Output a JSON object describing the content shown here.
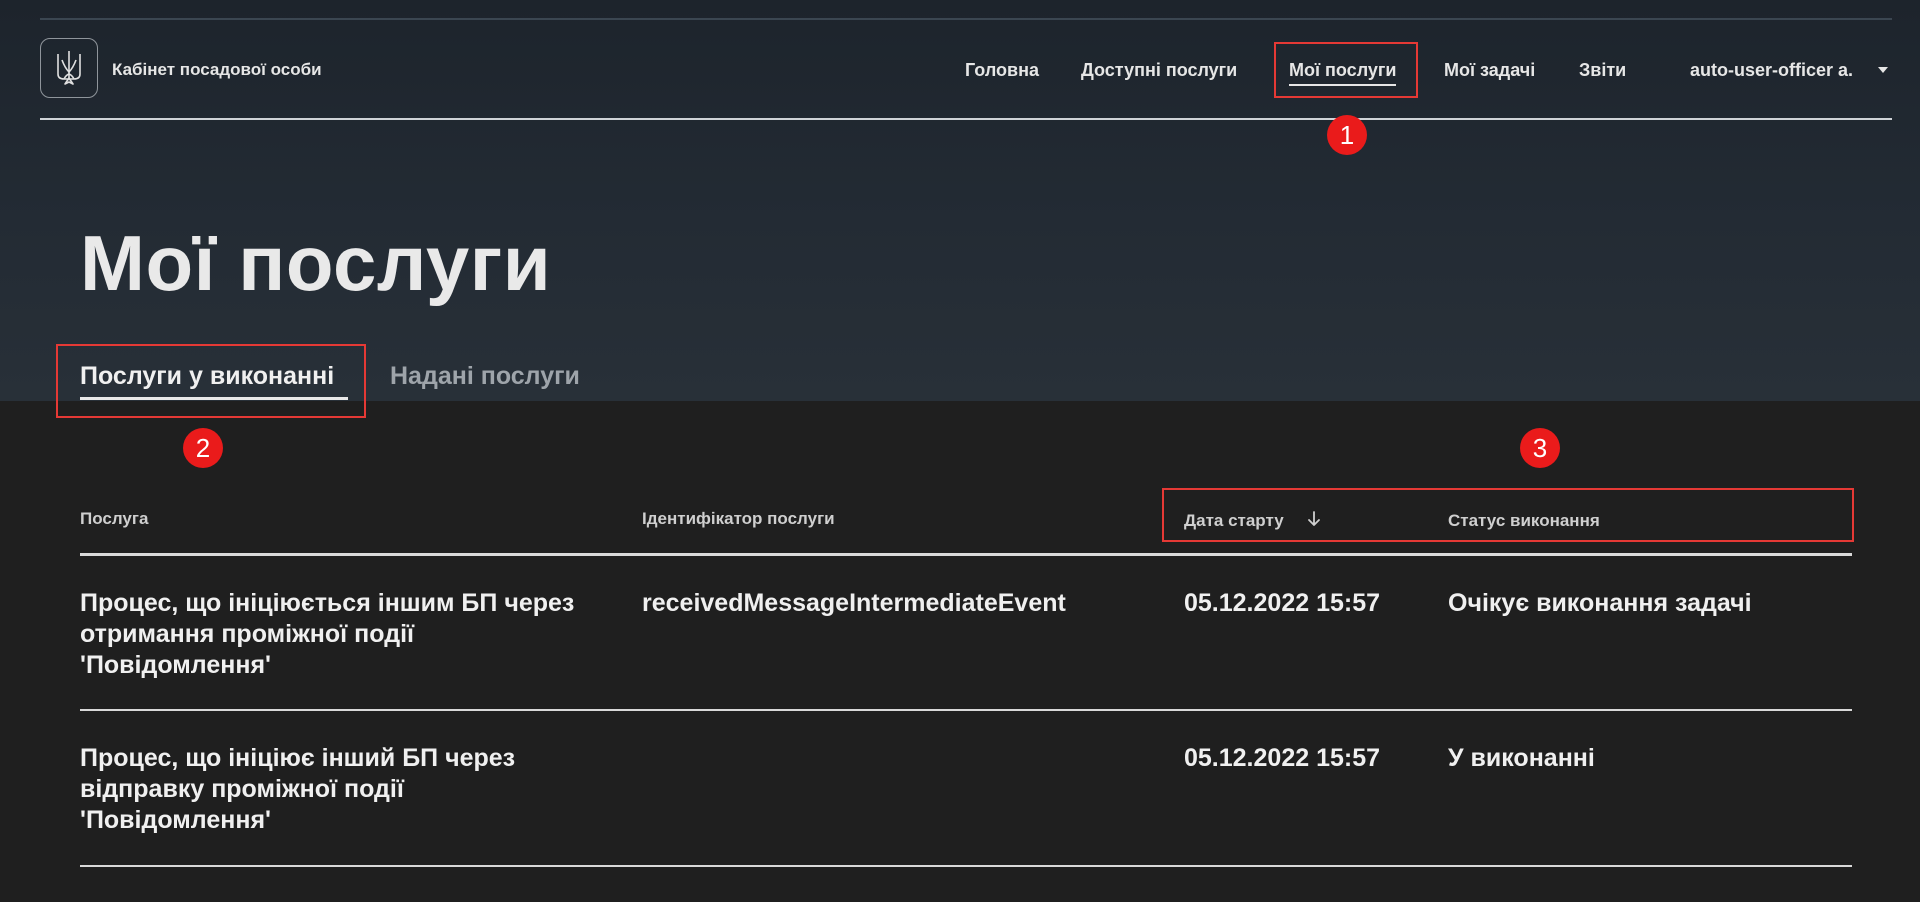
{
  "header": {
    "brand": "Кабінет посадової особи",
    "nav": [
      {
        "label": "Головна"
      },
      {
        "label": "Доступні послуги"
      },
      {
        "label": "Мої послуги"
      },
      {
        "label": "Мої задачі"
      },
      {
        "label": "Звіти"
      }
    ],
    "user": "auto-user-officer a."
  },
  "page": {
    "title": "Мої послуги"
  },
  "tabs": [
    {
      "label": "Послуги у виконанні",
      "active": true
    },
    {
      "label": "Надані послуги",
      "active": false
    }
  ],
  "table": {
    "columns": [
      "Послуга",
      "Ідентифікатор послуги",
      "Дата старту",
      "Статус виконання"
    ],
    "rows": [
      {
        "service": [
          "Процес, що ініціюється іншим БП через",
          "отримання проміжної події",
          "'Повідомлення'"
        ],
        "id": "receivedMessageIntermediateEvent",
        "date": "05.12.2022 15:57",
        "status": "Очікує виконання задачі"
      },
      {
        "service": [
          "Процес, що ініціює інший БП через",
          "відправку проміжної події",
          "'Повідомлення'"
        ],
        "id": "",
        "date": "05.12.2022 15:57",
        "status": "У виконанні"
      }
    ]
  },
  "annotations": {
    "badges": [
      "1",
      "2",
      "3"
    ],
    "color": "#ea1b1b"
  }
}
